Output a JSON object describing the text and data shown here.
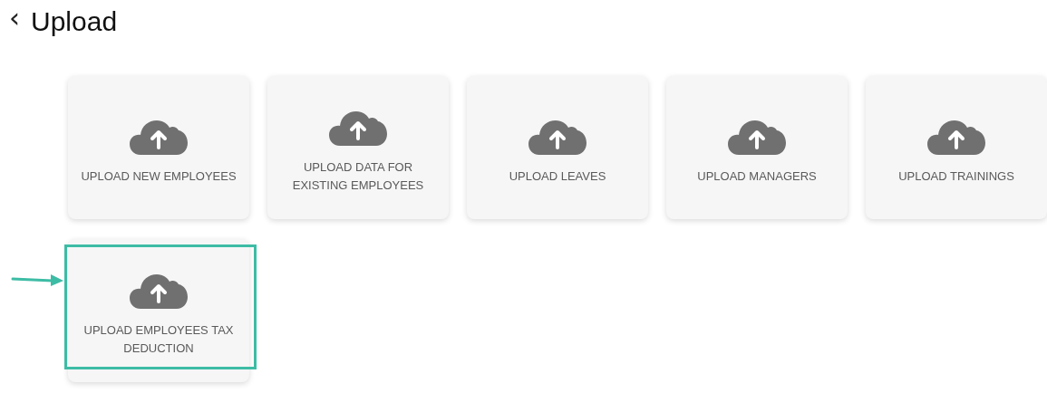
{
  "header": {
    "back": "‹",
    "title": "Upload"
  },
  "cards": [
    {
      "label": "UPLOAD NEW EMPLOYEES",
      "highlighted": false
    },
    {
      "label": "UPLOAD DATA FOR EXISTING EMPLOYEES",
      "highlighted": false
    },
    {
      "label": "UPLOAD LEAVES",
      "highlighted": false
    },
    {
      "label": "UPLOAD MANAGERS",
      "highlighted": false
    },
    {
      "label": "UPLOAD TRAININGS",
      "highlighted": false
    },
    {
      "label": "UPLOAD EMPLOYEES TAX DEDUCTION",
      "highlighted": true
    }
  ]
}
